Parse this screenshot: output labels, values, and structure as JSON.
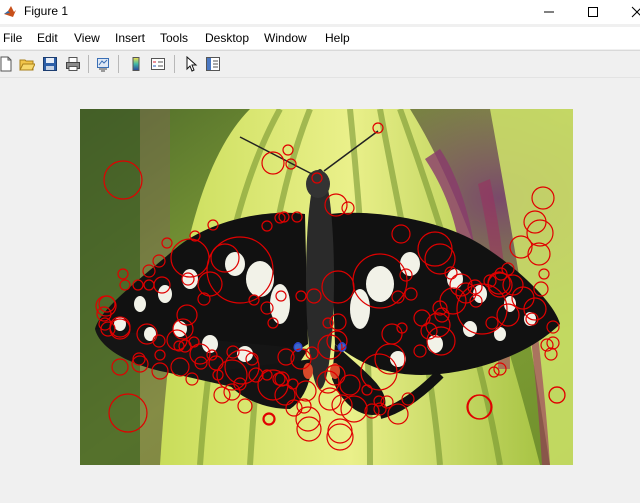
{
  "window": {
    "title": "Figure 1"
  },
  "menu": [
    "File",
    "Edit",
    "View",
    "Insert",
    "Tools",
    "Desktop",
    "Window",
    "Help"
  ],
  "toolbar": {
    "icons": [
      "new-figure-icon",
      "open-file-icon",
      "save-icon",
      "print-icon",
      "link-plot-icon",
      "insert-colorbar-icon",
      "insert-legend-icon",
      "edit-plot-icon",
      "property-inspector-icon"
    ]
  },
  "colors": {
    "marker_red": "#e00000",
    "marker_blue": "#2a3fd0"
  },
  "figure": {
    "image_subject": "swallowtail butterfly on green-yellow striped leaf",
    "marker_shape": "circle"
  }
}
